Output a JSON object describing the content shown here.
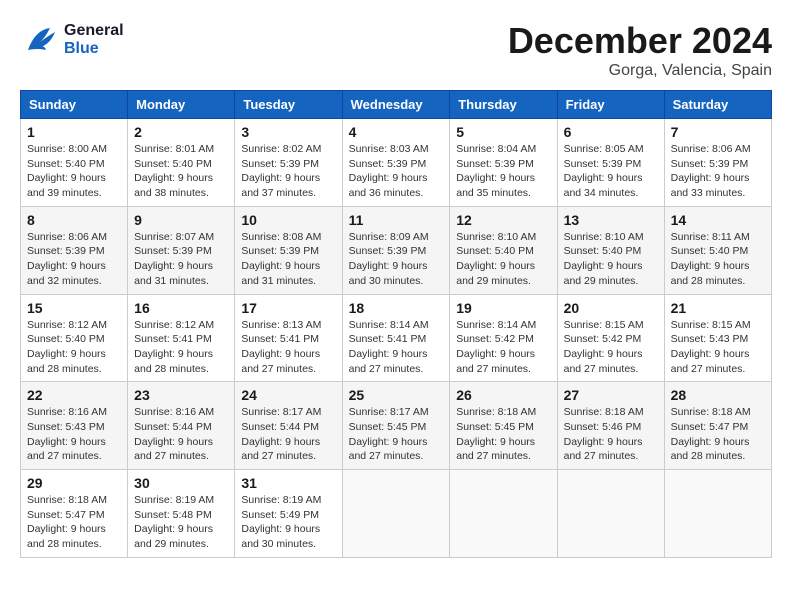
{
  "header": {
    "logo_general": "General",
    "logo_blue": "Blue",
    "month_title": "December 2024",
    "location": "Gorga, Valencia, Spain"
  },
  "days_of_week": [
    "Sunday",
    "Monday",
    "Tuesday",
    "Wednesday",
    "Thursday",
    "Friday",
    "Saturday"
  ],
  "weeks": [
    [
      {
        "day": "1",
        "sunrise": "Sunrise: 8:00 AM",
        "sunset": "Sunset: 5:40 PM",
        "daylight": "Daylight: 9 hours and 39 minutes."
      },
      {
        "day": "2",
        "sunrise": "Sunrise: 8:01 AM",
        "sunset": "Sunset: 5:40 PM",
        "daylight": "Daylight: 9 hours and 38 minutes."
      },
      {
        "day": "3",
        "sunrise": "Sunrise: 8:02 AM",
        "sunset": "Sunset: 5:39 PM",
        "daylight": "Daylight: 9 hours and 37 minutes."
      },
      {
        "day": "4",
        "sunrise": "Sunrise: 8:03 AM",
        "sunset": "Sunset: 5:39 PM",
        "daylight": "Daylight: 9 hours and 36 minutes."
      },
      {
        "day": "5",
        "sunrise": "Sunrise: 8:04 AM",
        "sunset": "Sunset: 5:39 PM",
        "daylight": "Daylight: 9 hours and 35 minutes."
      },
      {
        "day": "6",
        "sunrise": "Sunrise: 8:05 AM",
        "sunset": "Sunset: 5:39 PM",
        "daylight": "Daylight: 9 hours and 34 minutes."
      },
      {
        "day": "7",
        "sunrise": "Sunrise: 8:06 AM",
        "sunset": "Sunset: 5:39 PM",
        "daylight": "Daylight: 9 hours and 33 minutes."
      }
    ],
    [
      {
        "day": "8",
        "sunrise": "Sunrise: 8:06 AM",
        "sunset": "Sunset: 5:39 PM",
        "daylight": "Daylight: 9 hours and 32 minutes."
      },
      {
        "day": "9",
        "sunrise": "Sunrise: 8:07 AM",
        "sunset": "Sunset: 5:39 PM",
        "daylight": "Daylight: 9 hours and 31 minutes."
      },
      {
        "day": "10",
        "sunrise": "Sunrise: 8:08 AM",
        "sunset": "Sunset: 5:39 PM",
        "daylight": "Daylight: 9 hours and 31 minutes."
      },
      {
        "day": "11",
        "sunrise": "Sunrise: 8:09 AM",
        "sunset": "Sunset: 5:39 PM",
        "daylight": "Daylight: 9 hours and 30 minutes."
      },
      {
        "day": "12",
        "sunrise": "Sunrise: 8:10 AM",
        "sunset": "Sunset: 5:40 PM",
        "daylight": "Daylight: 9 hours and 29 minutes."
      },
      {
        "day": "13",
        "sunrise": "Sunrise: 8:10 AM",
        "sunset": "Sunset: 5:40 PM",
        "daylight": "Daylight: 9 hours and 29 minutes."
      },
      {
        "day": "14",
        "sunrise": "Sunrise: 8:11 AM",
        "sunset": "Sunset: 5:40 PM",
        "daylight": "Daylight: 9 hours and 28 minutes."
      }
    ],
    [
      {
        "day": "15",
        "sunrise": "Sunrise: 8:12 AM",
        "sunset": "Sunset: 5:40 PM",
        "daylight": "Daylight: 9 hours and 28 minutes."
      },
      {
        "day": "16",
        "sunrise": "Sunrise: 8:12 AM",
        "sunset": "Sunset: 5:41 PM",
        "daylight": "Daylight: 9 hours and 28 minutes."
      },
      {
        "day": "17",
        "sunrise": "Sunrise: 8:13 AM",
        "sunset": "Sunset: 5:41 PM",
        "daylight": "Daylight: 9 hours and 27 minutes."
      },
      {
        "day": "18",
        "sunrise": "Sunrise: 8:14 AM",
        "sunset": "Sunset: 5:41 PM",
        "daylight": "Daylight: 9 hours and 27 minutes."
      },
      {
        "day": "19",
        "sunrise": "Sunrise: 8:14 AM",
        "sunset": "Sunset: 5:42 PM",
        "daylight": "Daylight: 9 hours and 27 minutes."
      },
      {
        "day": "20",
        "sunrise": "Sunrise: 8:15 AM",
        "sunset": "Sunset: 5:42 PM",
        "daylight": "Daylight: 9 hours and 27 minutes."
      },
      {
        "day": "21",
        "sunrise": "Sunrise: 8:15 AM",
        "sunset": "Sunset: 5:43 PM",
        "daylight": "Daylight: 9 hours and 27 minutes."
      }
    ],
    [
      {
        "day": "22",
        "sunrise": "Sunrise: 8:16 AM",
        "sunset": "Sunset: 5:43 PM",
        "daylight": "Daylight: 9 hours and 27 minutes."
      },
      {
        "day": "23",
        "sunrise": "Sunrise: 8:16 AM",
        "sunset": "Sunset: 5:44 PM",
        "daylight": "Daylight: 9 hours and 27 minutes."
      },
      {
        "day": "24",
        "sunrise": "Sunrise: 8:17 AM",
        "sunset": "Sunset: 5:44 PM",
        "daylight": "Daylight: 9 hours and 27 minutes."
      },
      {
        "day": "25",
        "sunrise": "Sunrise: 8:17 AM",
        "sunset": "Sunset: 5:45 PM",
        "daylight": "Daylight: 9 hours and 27 minutes."
      },
      {
        "day": "26",
        "sunrise": "Sunrise: 8:18 AM",
        "sunset": "Sunset: 5:45 PM",
        "daylight": "Daylight: 9 hours and 27 minutes."
      },
      {
        "day": "27",
        "sunrise": "Sunrise: 8:18 AM",
        "sunset": "Sunset: 5:46 PM",
        "daylight": "Daylight: 9 hours and 27 minutes."
      },
      {
        "day": "28",
        "sunrise": "Sunrise: 8:18 AM",
        "sunset": "Sunset: 5:47 PM",
        "daylight": "Daylight: 9 hours and 28 minutes."
      }
    ],
    [
      {
        "day": "29",
        "sunrise": "Sunrise: 8:18 AM",
        "sunset": "Sunset: 5:47 PM",
        "daylight": "Daylight: 9 hours and 28 minutes."
      },
      {
        "day": "30",
        "sunrise": "Sunrise: 8:19 AM",
        "sunset": "Sunset: 5:48 PM",
        "daylight": "Daylight: 9 hours and 29 minutes."
      },
      {
        "day": "31",
        "sunrise": "Sunrise: 8:19 AM",
        "sunset": "Sunset: 5:49 PM",
        "daylight": "Daylight: 9 hours and 30 minutes."
      },
      null,
      null,
      null,
      null
    ]
  ]
}
